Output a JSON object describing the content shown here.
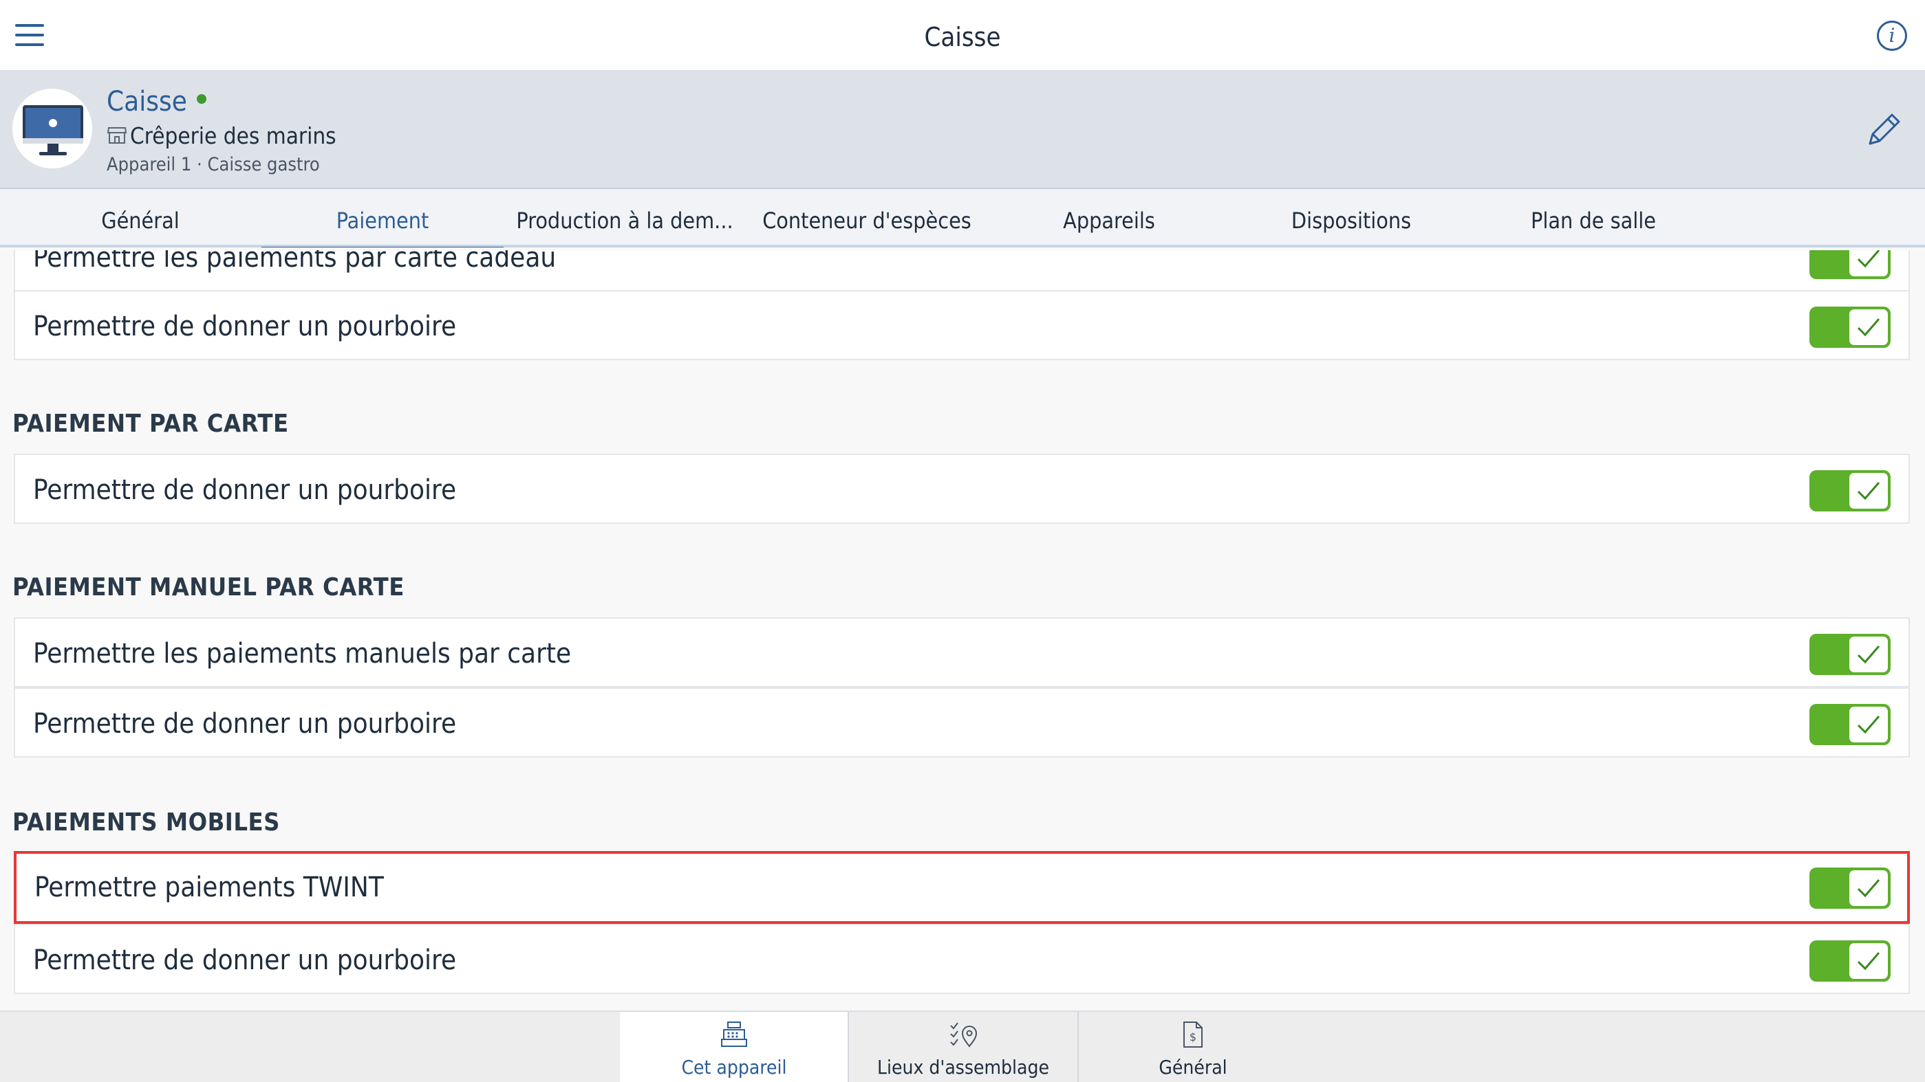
{
  "topbar": {
    "title": "Caisse"
  },
  "device": {
    "name": "Caisse",
    "location": "Crêperie des marins",
    "meta": "Appareil 1 · Caisse gastro"
  },
  "tabs": [
    {
      "label": "Général"
    },
    {
      "label": "Paiement"
    },
    {
      "label": "Production à la dem..."
    },
    {
      "label": "Conteneur d'espèces"
    },
    {
      "label": "Appareils"
    },
    {
      "label": "Dispositions"
    },
    {
      "label": "Plan de salle"
    }
  ],
  "active_tab": "Paiement",
  "settings": {
    "gift_card_rows": [
      {
        "label": "Permettre les paiements par carte cadeau",
        "enabled": true
      },
      {
        "label": "Permettre de donner un pourboire",
        "enabled": true
      }
    ],
    "card_section": {
      "title": "PAIEMENT PAR CARTE",
      "rows": [
        {
          "label": "Permettre de donner un pourboire",
          "enabled": true
        }
      ]
    },
    "manual_card_section": {
      "title": "PAIEMENT MANUEL PAR CARTE",
      "rows": [
        {
          "label": "Permettre les paiements manuels par carte",
          "enabled": true
        },
        {
          "label": "Permettre de donner un pourboire",
          "enabled": true
        }
      ]
    },
    "mobile_section": {
      "title": "PAIEMENTS MOBILES",
      "rows": [
        {
          "label": "Permettre paiements TWINT",
          "enabled": true,
          "highlighted": true
        },
        {
          "label": "Permettre de donner un pourboire",
          "enabled": true
        }
      ]
    }
  },
  "bottom_tabs": [
    {
      "label": "Cet appareil",
      "icon": "cash-register-icon",
      "active": true
    },
    {
      "label": "Lieux d'assemblage",
      "icon": "checklist-pin-icon",
      "active": false
    },
    {
      "label": "Général",
      "icon": "document-dollar-icon",
      "active": false
    }
  ],
  "colors": {
    "accent": "#2d5d96",
    "toggle_on": "#5cb02a",
    "highlight": "#e53935",
    "online": "#3c9a2e",
    "header_bg": "#dde2e9"
  }
}
